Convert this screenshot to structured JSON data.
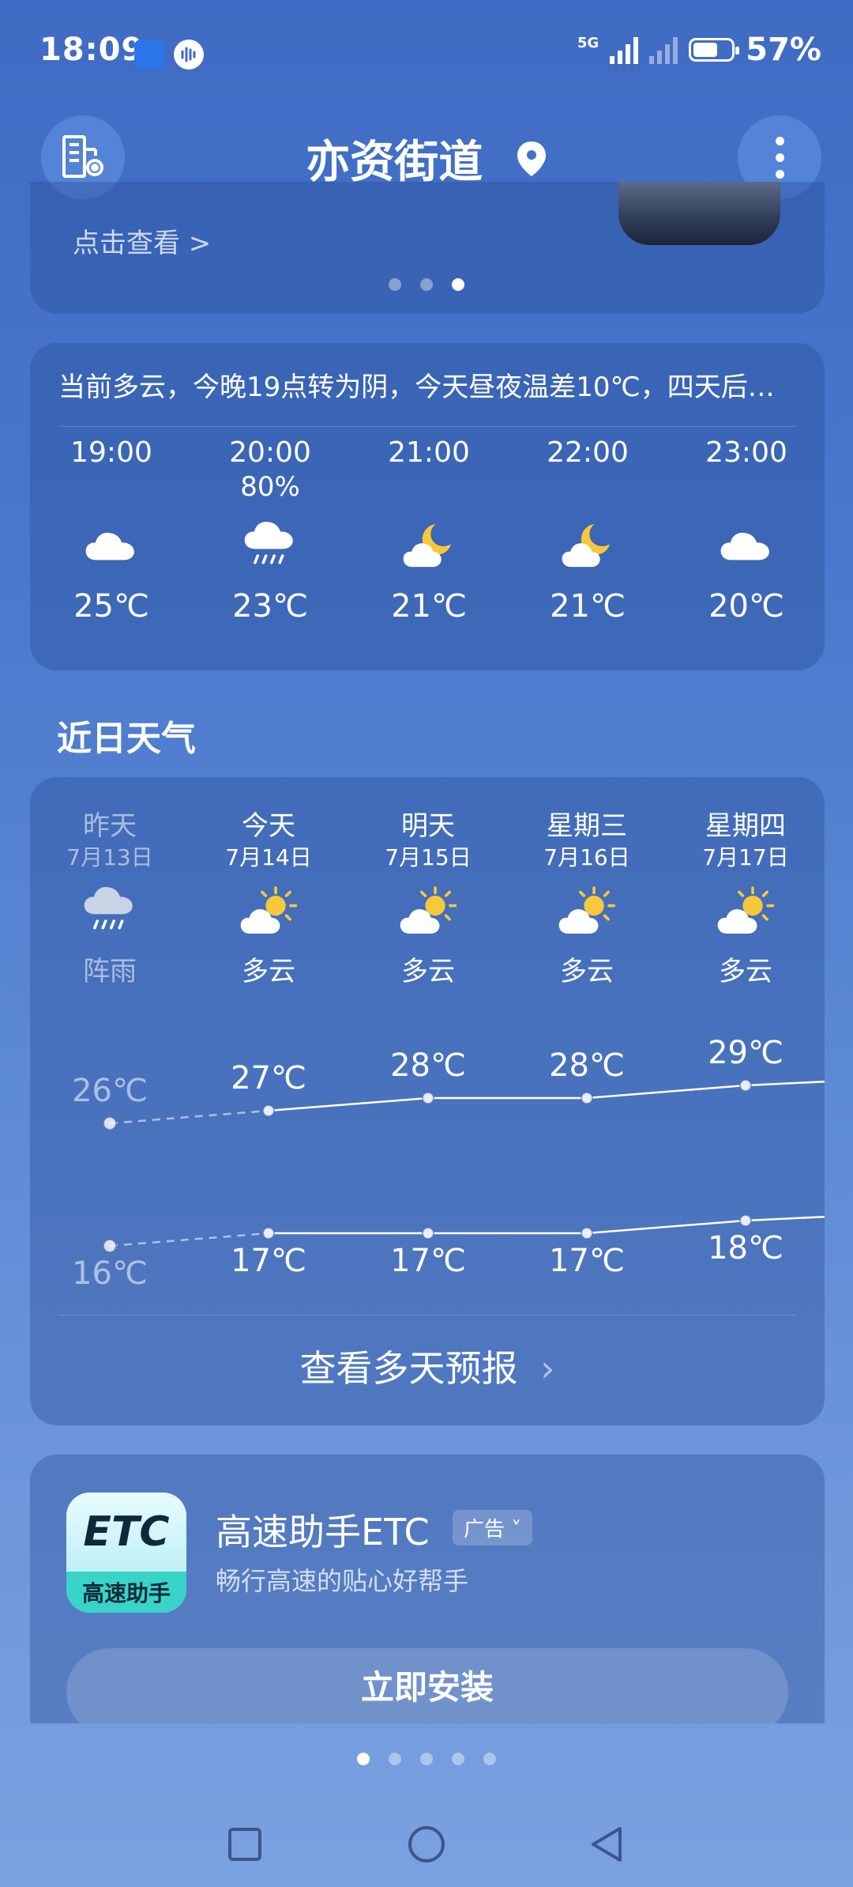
{
  "status_bar": {
    "time": "18:09",
    "network": "5G",
    "battery": "57%"
  },
  "header": {
    "title": "亦资街道",
    "city_manager_icon": "building-gear-icon",
    "location_icon": "location-pin-icon",
    "menu_icon": "more-vertical-icon"
  },
  "top_card": {
    "link_text": "点击查看 >"
  },
  "hourly": {
    "summary": "当前多云，今晚19点转为阴，今天昼夜温差10℃，四天后…",
    "items": [
      {
        "time": "19:00",
        "precip": "",
        "icon": "cloudy-icon",
        "temp": "25℃"
      },
      {
        "time": "20:00",
        "precip": "80%",
        "icon": "rain-icon",
        "temp": "23℃"
      },
      {
        "time": "21:00",
        "precip": "",
        "icon": "partly-cloudy-night-icon",
        "temp": "21℃"
      },
      {
        "time": "22:00",
        "precip": "",
        "icon": "partly-cloudy-night-icon",
        "temp": "21℃"
      },
      {
        "time": "23:00",
        "precip": "",
        "icon": "cloudy-icon",
        "temp": "20℃"
      }
    ]
  },
  "recent": {
    "title": "近日天气",
    "days": [
      {
        "name": "昨天",
        "date": "7月13日",
        "icon": "shower-icon",
        "weather": "阵雨",
        "high": "26℃",
        "low": "16℃",
        "past": true
      },
      {
        "name": "今天",
        "date": "7月14日",
        "icon": "partly-cloudy-day-icon",
        "weather": "多云",
        "high": "27℃",
        "low": "17℃",
        "past": false
      },
      {
        "name": "明天",
        "date": "7月15日",
        "icon": "partly-cloudy-day-icon",
        "weather": "多云",
        "high": "28℃",
        "low": "17℃",
        "past": false
      },
      {
        "name": "星期三",
        "date": "7月16日",
        "icon": "partly-cloudy-day-icon",
        "weather": "多云",
        "high": "28℃",
        "low": "17℃",
        "past": false
      },
      {
        "name": "星期四",
        "date": "7月17日",
        "icon": "partly-cloudy-day-icon",
        "weather": "多云",
        "high": "29℃",
        "low": "18℃",
        "past": false
      }
    ],
    "more_label": "查看多天预报"
  },
  "ad": {
    "logo_text": "ETC",
    "logo_sub": "高速助手",
    "title": "高速助手ETC",
    "badge": "广告",
    "subtitle": "畅行高速的贴心好帮手",
    "button": "立即安装"
  },
  "nav": {
    "recent_icon": "square-recent-icon",
    "home_icon": "circle-home-icon",
    "back_icon": "triangle-back-icon"
  }
}
